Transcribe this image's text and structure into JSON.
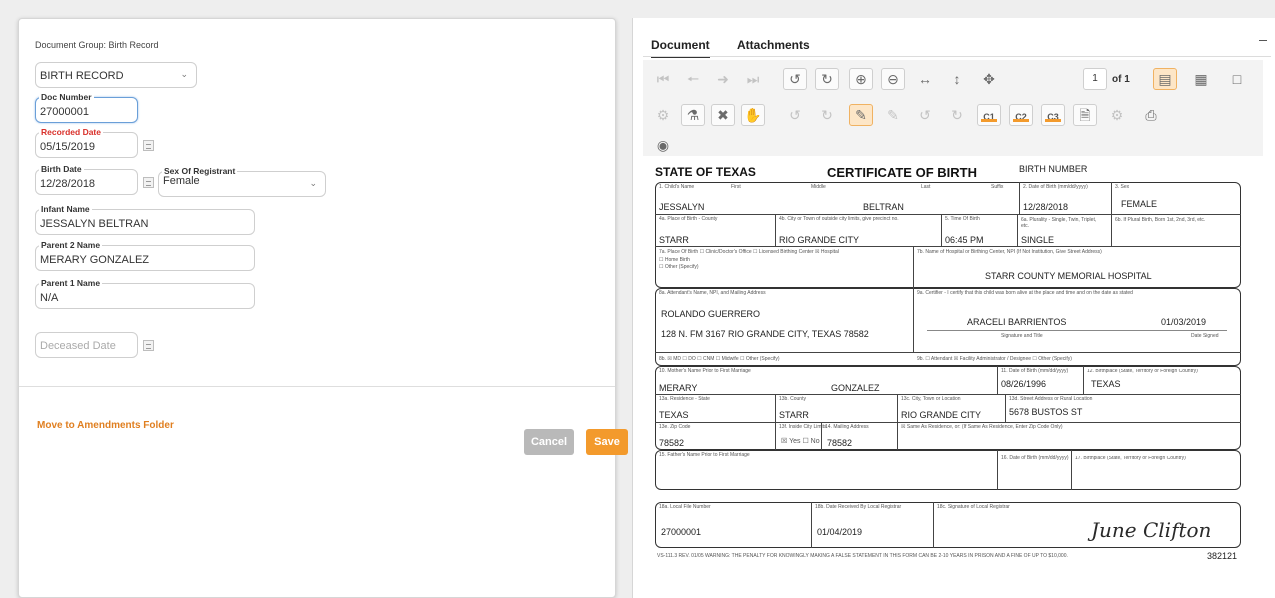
{
  "form": {
    "document_group": "Document Group: Birth Record",
    "record_type": "BIRTH RECORD",
    "doc_number_label": "Doc Number",
    "doc_number": "27000001",
    "recorded_date_label": "Recorded Date",
    "recorded_date": "05/15/2019",
    "birth_date_label": "Birth Date",
    "birth_date": "12/28/2018",
    "sex_label": "Sex Of Registrant",
    "sex": "Female",
    "infant_name_label": "Infant Name",
    "infant_name": "JESSALYN BELTRAN",
    "parent2_label": "Parent 2 Name",
    "parent2": "MERARY GONZALEZ",
    "parent1_label": "Parent 1 Name",
    "parent1": "N/A",
    "deceased_placeholder": "Deceased Date",
    "move_link": "Move to Amendments Folder",
    "cancel": "Cancel",
    "save": "Save"
  },
  "viewer": {
    "tabs": [
      "Document",
      "Attachments"
    ],
    "page_number": "1",
    "page_of": "of 1",
    "toolbar_icons": [
      "first-page-icon",
      "previous-page-icon",
      "next-page-icon",
      "last-page-icon",
      "rotate-left-icon",
      "rotate-right-icon",
      "zoom-in-icon",
      "zoom-out-icon",
      "fit-width-icon",
      "fit-height-icon",
      "pan-icon",
      "view-single-icon",
      "view-grid-icon",
      "crop-icon",
      "annotation-icon",
      "stamp-icon",
      "redact-icon",
      "hand-icon",
      "undo-icon",
      "redo-icon",
      "highlight-icon",
      "hide-highlight-icon",
      "rotate-page-left-icon",
      "rotate-page-right-icon",
      "copy-1-icon",
      "copy-2-icon",
      "copy-3-icon",
      "document-icon",
      "compare-icon",
      "print-icon",
      "eye-icon"
    ],
    "copy_labels": [
      "C1",
      "C2",
      "C3"
    ]
  },
  "certificate": {
    "state": "STATE OF TEXAS",
    "title": "CERTIFICATE OF BIRTH",
    "birth_number_label": "BIRTH NUMBER",
    "l_child_name": "1. Child's Name",
    "l_first": "First",
    "l_middle": "Middle",
    "l_last": "Last",
    "l_suffix": "Suffix",
    "l_dob": "2. Date of Birth (mm/dd/yyyy)",
    "l_sex": "3. Sex",
    "child_first": "JESSALYN",
    "child_last": "BELTRAN",
    "dob": "12/28/2018",
    "sex": "FEMALE",
    "l_county": "4a. Place of Birth - County",
    "l_city": "4b. City or Town of outside city limits, give precinct no.",
    "l_time": "5. Time Of Birth",
    "l_plurality": "6a. Plurality - Single, Twin, Triplet, etc.",
    "l_plural_order": "6b. If Plural Birth, Born 1st, 2nd, 3rd, etc.",
    "county": "STARR",
    "city": "RIO GRANDE CITY",
    "time": "06:45 PM",
    "plurality": "SINGLE",
    "l_place": "7a. Place Of Birth ☐ Clinic/Doctor's Office ☐ Licensed Birthing Center ☒ Hospital",
    "l_home": "☐ Home Birth",
    "l_other": "☐ Other (Specify)",
    "l_hospital": "7b. Name of Hospital or Birthing Center, NPI (If Not Institution, Give Street Address)",
    "hospital": "STARR COUNTY MEMORIAL HOSPITAL",
    "l_attendant": "8a. Attendant's Name, NPI, and Mailing Address",
    "attendant": "ROLANDO GUERRERO",
    "attendant_address": "128 N. FM 3167 RIO GRANDE CITY, TEXAS 78582",
    "l_certifier": "9a. Certifier - I certify that this child was born alive at the place and time and on the date as stated",
    "certifier": "ARACELI BARRIENTOS",
    "certifier_date": "01/03/2019",
    "l_sig_title": "Signature and Title",
    "l_date_signed": "Date Signed",
    "l_8b": "8b. ☒ MD ☐ DO ☐ CNM ☐ Midwife ☐ Other (Specify)",
    "l_9b": "9b. ☐ Attendant ☒ Facility Administrator / Designee ☐ Other (Specify)",
    "l_mother": "10. Mother's Name Prior to First Marriage",
    "mother_first": "MERARY",
    "mother_last": "GONZALEZ",
    "l_mother_dob": "11. Date of Birth (mm/dd/yyyy)",
    "mother_dob": "08/26/1996",
    "l_birthplace": "12. Birthplace (State, Territory or Foreign Country)",
    "mother_birthplace": "TEXAS",
    "l_residence": "13a. Residence - State",
    "residence": "TEXAS",
    "l_res_county": "13b. County",
    "res_county": "STARR",
    "l_res_city": "13c. City, Town or Location",
    "res_city": "RIO GRANDE CITY",
    "l_street": "13d. Street Address or Rural Location",
    "street": "5678 BUSTOS ST",
    "l_zip": "13e. Zip Code",
    "zip": "78582",
    "l_inside_city": "13f. Inside City Limits",
    "inside_city": "☒ Yes ☐ No",
    "l_mailing": "14. Mailing Address",
    "mailing": "78582",
    "l_same": "☒ Same As Residence, or: (If Same As Residence, Enter Zip Code Only)",
    "l_father": "15. Father's Name Prior to First Marriage",
    "l_father_dob": "16. Date of Birth (mm/dd/yyyy)",
    "l_father_bp": "17. Birthplace (State, Territory or Foreign Country)",
    "l_local_file": "18a. Local File Number",
    "local_file": "27000001",
    "l_date_received": "18b. Date Received By Local Registrar",
    "date_received": "01/04/2019",
    "l_registrar": "18c. Signature of Local Registrar",
    "signature": "June Clifton",
    "footer": "VS-111.3    REV. 01/05  WARNING: THE PENALTY FOR KNOWINGLY MAKING A FALSE STATEMENT IN THIS FORM CAN BE 2-10 YEARS IN PRISON AND A FINE OF UP TO $10,000.",
    "form_no": "382121"
  }
}
